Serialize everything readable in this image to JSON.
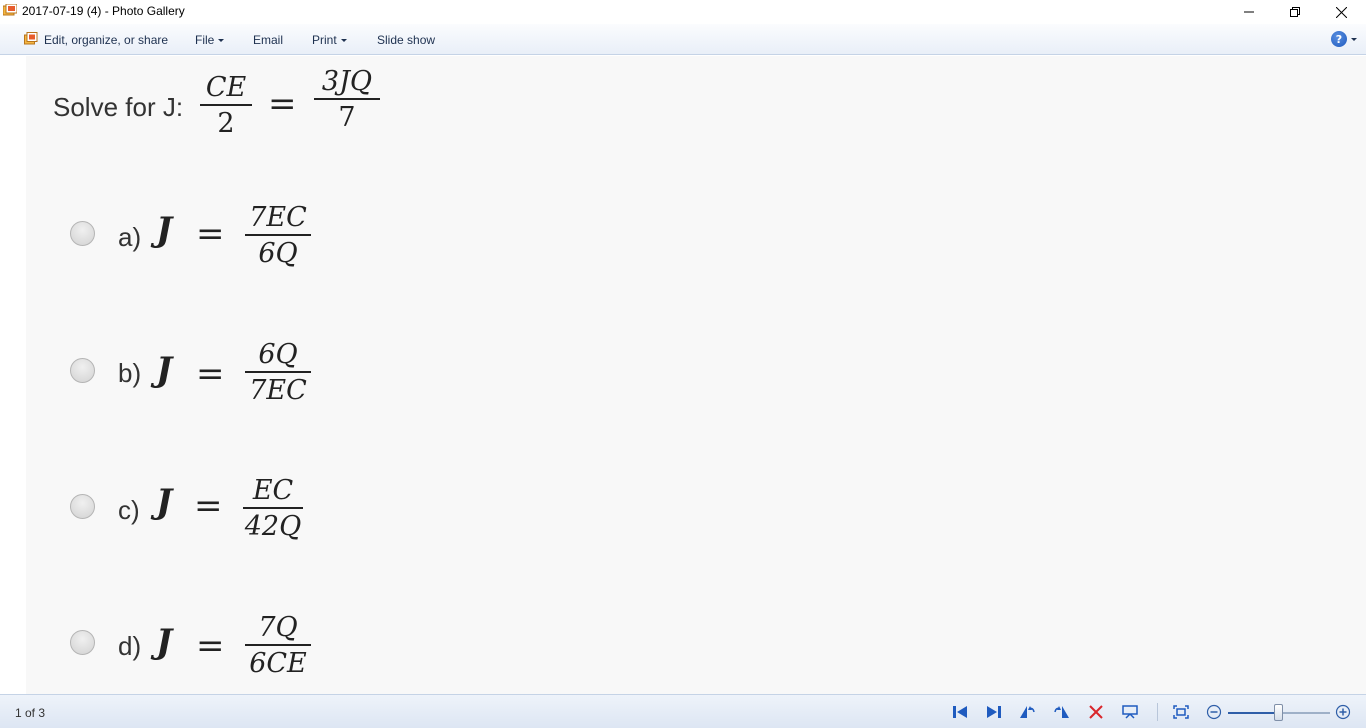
{
  "window": {
    "title": "2017-07-19 (4) - Photo Gallery",
    "controls": [
      "minimize",
      "restore",
      "close"
    ]
  },
  "menubar": {
    "edit_label": "Edit, organize, or share",
    "file_label": "File",
    "email_label": "Email",
    "print_label": "Print",
    "slideshow_label": "Slide show",
    "help_glyph": "?"
  },
  "content": {
    "question_prefix": "Solve for J:",
    "question_lhs_num": "CE",
    "question_lhs_den": "2",
    "question_rhs_num": "3JQ",
    "question_rhs_den": "7",
    "equals": "=",
    "options": [
      {
        "label": "a)",
        "var": "J",
        "num": "7EC",
        "den": "6Q"
      },
      {
        "label": "b)",
        "var": "J",
        "num": "6Q",
        "den": "7EC"
      },
      {
        "label": "c)",
        "var": "J",
        "num": "EC",
        "den": "42Q"
      },
      {
        "label": "d)",
        "var": "J",
        "num": "7Q",
        "den": "6CE"
      }
    ]
  },
  "statusbar": {
    "page_indicator": "1 of 3",
    "zoom_level": 0.5
  },
  "colors": {
    "accent": "#2e5ea8",
    "delete": "#d9262c",
    "menubar": "#e9eff8"
  }
}
